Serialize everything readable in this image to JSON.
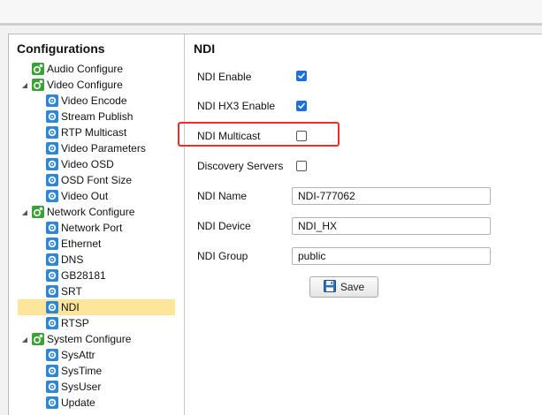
{
  "sidebar": {
    "title": "Configurations",
    "items": [
      {
        "label": "Audio Configure",
        "level": 1,
        "toggle": "",
        "selected": false
      },
      {
        "label": "Video Configure",
        "level": 1,
        "toggle": "◢",
        "selected": false
      },
      {
        "label": "Video Encode",
        "level": 2,
        "toggle": "",
        "selected": false
      },
      {
        "label": "Stream Publish",
        "level": 2,
        "toggle": "",
        "selected": false
      },
      {
        "label": "RTP Multicast",
        "level": 2,
        "toggle": "",
        "selected": false
      },
      {
        "label": "Video Parameters",
        "level": 2,
        "toggle": "",
        "selected": false
      },
      {
        "label": "Video OSD",
        "level": 2,
        "toggle": "",
        "selected": false
      },
      {
        "label": "OSD Font Size",
        "level": 2,
        "toggle": "",
        "selected": false
      },
      {
        "label": "Video Out",
        "level": 2,
        "toggle": "",
        "selected": false
      },
      {
        "label": "Network Configure",
        "level": 1,
        "toggle": "◢",
        "selected": false
      },
      {
        "label": "Network Port",
        "level": 2,
        "toggle": "",
        "selected": false
      },
      {
        "label": "Ethernet",
        "level": 2,
        "toggle": "",
        "selected": false
      },
      {
        "label": "DNS",
        "level": 2,
        "toggle": "",
        "selected": false
      },
      {
        "label": "GB28181",
        "level": 2,
        "toggle": "",
        "selected": false
      },
      {
        "label": "SRT",
        "level": 2,
        "toggle": "",
        "selected": false
      },
      {
        "label": "NDI",
        "level": 2,
        "toggle": "",
        "selected": true
      },
      {
        "label": "RTSP",
        "level": 2,
        "toggle": "",
        "selected": false
      },
      {
        "label": "System Configure",
        "level": 1,
        "toggle": "◢",
        "selected": false
      },
      {
        "label": "SysAttr",
        "level": 2,
        "toggle": "",
        "selected": false
      },
      {
        "label": "SysTime",
        "level": 2,
        "toggle": "",
        "selected": false
      },
      {
        "label": "SysUser",
        "level": 2,
        "toggle": "",
        "selected": false
      },
      {
        "label": "Update",
        "level": 2,
        "toggle": "",
        "selected": false
      }
    ]
  },
  "main": {
    "title": "NDI",
    "checkboxes": [
      {
        "label": "NDI Enable",
        "checked": true
      },
      {
        "label": "NDI HX3 Enable",
        "checked": true
      },
      {
        "label": "NDI Multicast",
        "checked": false
      },
      {
        "label": "Discovery Servers",
        "checked": false
      }
    ],
    "fields": [
      {
        "label": "NDI Name",
        "value": "NDI-777062"
      },
      {
        "label": "NDI Device",
        "value": "NDI_HX"
      },
      {
        "label": "NDI Group",
        "value": "public"
      }
    ],
    "save_label": "Save"
  },
  "colors": {
    "highlight": "#e5302b",
    "checkbox_checked": "#1f6fd6",
    "selected_item": "#fde59a",
    "gear_green": "#3aa135",
    "gear_blue": "#2e86d6"
  }
}
